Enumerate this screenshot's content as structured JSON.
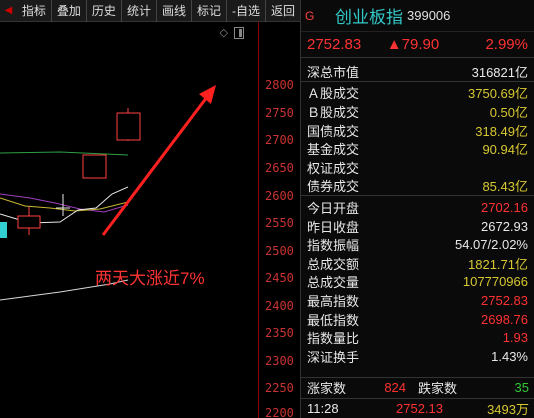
{
  "toolbar": {
    "items": [
      "指标",
      "叠加",
      "历史",
      "统计",
      "画线",
      "标记",
      "-自选",
      "返回"
    ]
  },
  "chart": {
    "price_axis_labels": [
      "2800",
      "2750",
      "2700",
      "2650",
      "2600",
      "2550",
      "2500",
      "2450",
      "2400",
      "2350",
      "2300",
      "2250",
      "2200"
    ],
    "annotation_text": "两天大涨近7%",
    "annotation_color": "#ff3333",
    "icons": [
      "diamond-icon",
      "panel-toggle-icon"
    ]
  },
  "quote": {
    "header_marker": "G",
    "name": "创业板指",
    "code": "399006",
    "last": "2752.83",
    "change": "▲79.90",
    "change_pct": "2.99%",
    "stats_group1": [
      {
        "label": "深总市值",
        "value": "316821亿",
        "color": "white"
      }
    ],
    "stats_group2": [
      {
        "label": "Ａ股成交",
        "value": "3750.69亿",
        "color": "yellow"
      },
      {
        "label": "Ｂ股成交",
        "value": "0.50亿",
        "color": "yellow"
      },
      {
        "label": "国债成交",
        "value": "318.49亿",
        "color": "yellow"
      },
      {
        "label": "基金成交",
        "value": "90.94亿",
        "color": "yellow"
      },
      {
        "label": "权证成交",
        "value": "",
        "color": "yellow"
      },
      {
        "label": "债券成交",
        "value": "85.43亿",
        "color": "yellow"
      }
    ],
    "stats_group3": [
      {
        "label": "今日开盘",
        "value": "2702.16",
        "color": "red"
      },
      {
        "label": "昨日收盘",
        "value": "2672.93",
        "color": "white"
      },
      {
        "label": "指数振幅",
        "value": "54.07/2.02%",
        "color": "white"
      },
      {
        "label": "总成交额",
        "value": "1821.71亿",
        "color": "yellow"
      },
      {
        "label": "总成交量",
        "value": "107770966",
        "color": "yellow"
      },
      {
        "label": "最高指数",
        "value": "2752.83",
        "color": "red"
      },
      {
        "label": "最低指数",
        "value": "2698.76",
        "color": "red"
      },
      {
        "label": "指数量比",
        "value": "1.93",
        "color": "red"
      },
      {
        "label": "深证换手",
        "value": "1.43%",
        "color": "white"
      }
    ],
    "breadth": {
      "up_label": "涨家数",
      "up_value": "824",
      "down_label": "跌家数",
      "down_value": "35"
    },
    "tick": {
      "time": "11:28",
      "price": "2752.13",
      "volume": "3493万"
    }
  }
}
